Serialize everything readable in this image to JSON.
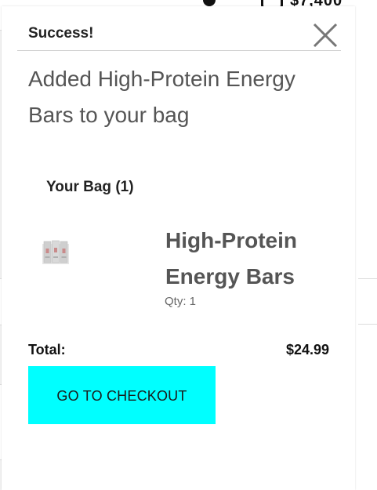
{
  "background": {
    "header_amount": "$7,400"
  },
  "modal": {
    "title": "Success!",
    "message": "Added High-Protein Energy Bars to your bag",
    "close_icon": "close-icon"
  },
  "bag": {
    "heading": "Your Bag (1)",
    "item": {
      "name": "High-Protein Energy Bars",
      "qty_label": "Qty: ",
      "qty_value": "1",
      "thumbnail_icon": "energy-bars-thumbnail"
    },
    "total_label": "Total:",
    "total_value": "$24.99",
    "checkout_label": "GO TO CHECKOUT"
  },
  "colors": {
    "checkout_button": "#00ffff",
    "message_text": "#555555",
    "close_icon": "#777777"
  }
}
